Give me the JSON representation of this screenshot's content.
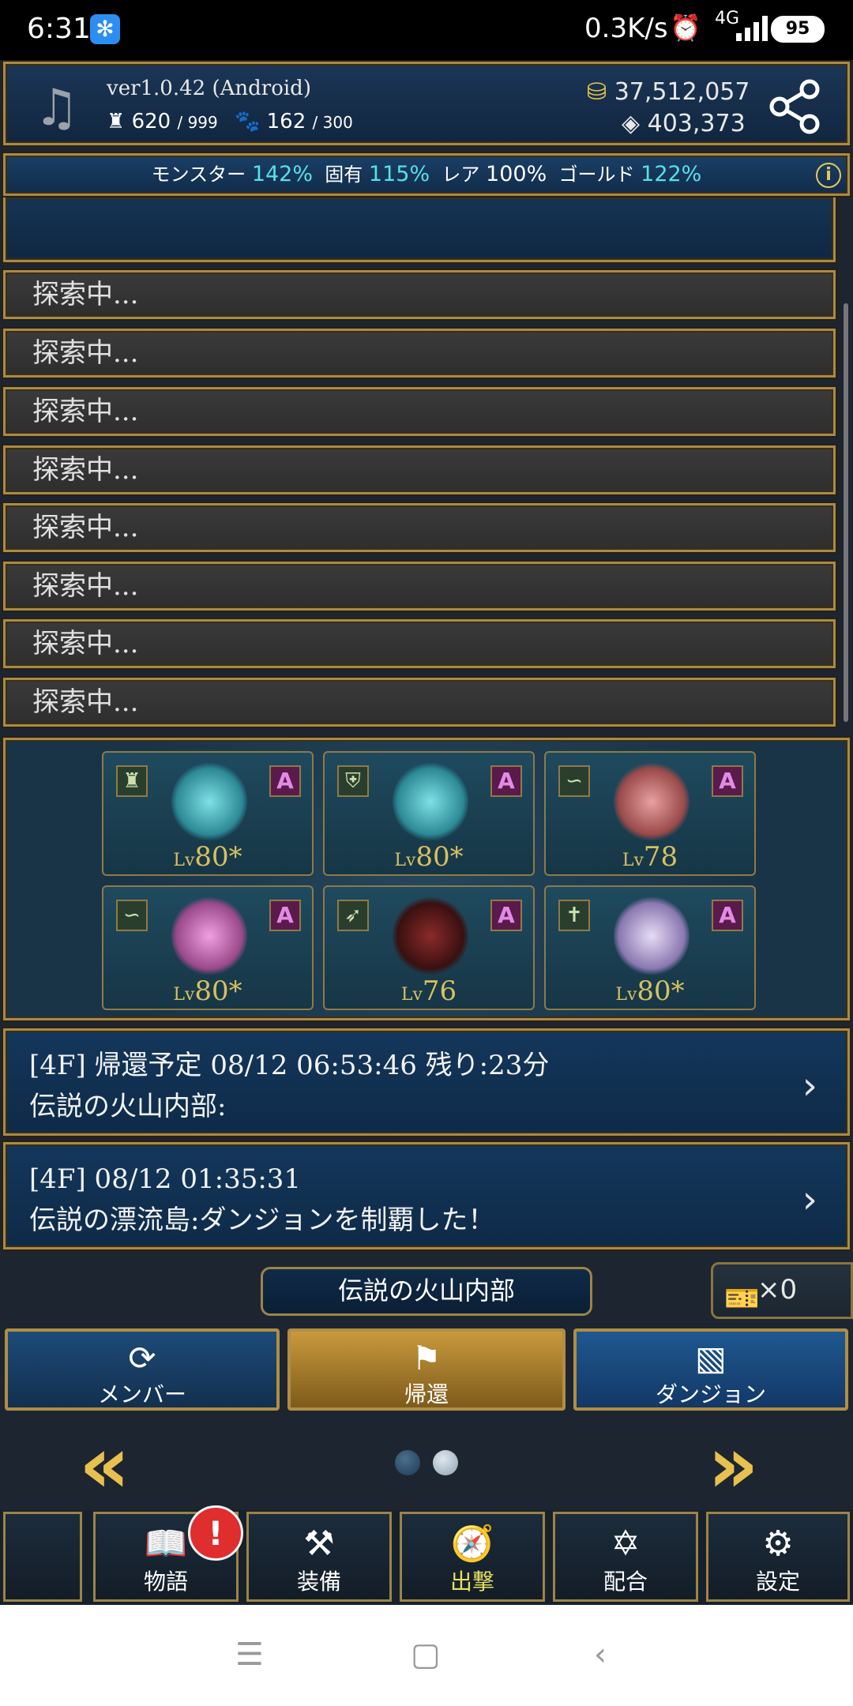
{
  "status_bar": {
    "time": "6:31",
    "network_speed": "0.3K/s",
    "network_type": "4G",
    "battery": "95"
  },
  "header": {
    "version": "ver1.0.42 (Android)",
    "castle_value": "620",
    "castle_max": "/ 999",
    "paw_value": "162",
    "paw_max": "/ 300",
    "gold": "37,512,057",
    "gems": "403,373"
  },
  "bonus": {
    "monster_label": "モンスター",
    "monster_pct": "142%",
    "unique_label": "固有",
    "unique_pct": "115%",
    "rare_label": "レア",
    "rare_pct": "100%",
    "gold_label": "ゴールド",
    "gold_pct": "122%"
  },
  "explore_rows": [
    "探索中...",
    "探索中...",
    "探索中...",
    "探索中...",
    "探索中...",
    "探索中...",
    "探索中...",
    "探索中..."
  ],
  "monsters": [
    {
      "lv_prefix": "Lv",
      "lv": "80*",
      "type": "castle",
      "rank": "A",
      "color": "#3fb6c0"
    },
    {
      "lv_prefix": "Lv",
      "lv": "80*",
      "type": "shield",
      "rank": "A",
      "color": "#3fb6c0"
    },
    {
      "lv_prefix": "Lv",
      "lv": "78",
      "type": "snake",
      "rank": "A",
      "color": "#c86a6a"
    },
    {
      "lv_prefix": "Lv",
      "lv": "80*",
      "type": "snake",
      "rank": "A",
      "color": "#c266b4"
    },
    {
      "lv_prefix": "Lv",
      "lv": "76",
      "type": "feather",
      "rank": "A",
      "color": "#6e2020"
    },
    {
      "lv_prefix": "Lv",
      "lv": "80*",
      "type": "cross",
      "rank": "A",
      "color": "#b6a0d8"
    }
  ],
  "logs": [
    {
      "line1": "[4F] 帰還予定 08/12 06:53:46 残り:23分",
      "line2": "伝説の火山内部:"
    },
    {
      "line1": "[4F] 08/12 01:35:31",
      "line2": "伝説の漂流島:ダンジョンを制覇した！"
    }
  ],
  "area_name": "伝説の火山内部",
  "ticket_count": "×0",
  "actions": {
    "member": "メンバー",
    "return": "帰還",
    "dungeon": "ダンジョン"
  },
  "nav": {
    "story": "物語",
    "equip": "装備",
    "sortie": "出撃",
    "fusion": "配合",
    "settings": "設定",
    "badge": "!"
  },
  "colors": {
    "accent_cyan": "#58e0e8",
    "gold": "#e8c050",
    "active_nav": "#e6e060",
    "badge": "#e02d2d"
  }
}
